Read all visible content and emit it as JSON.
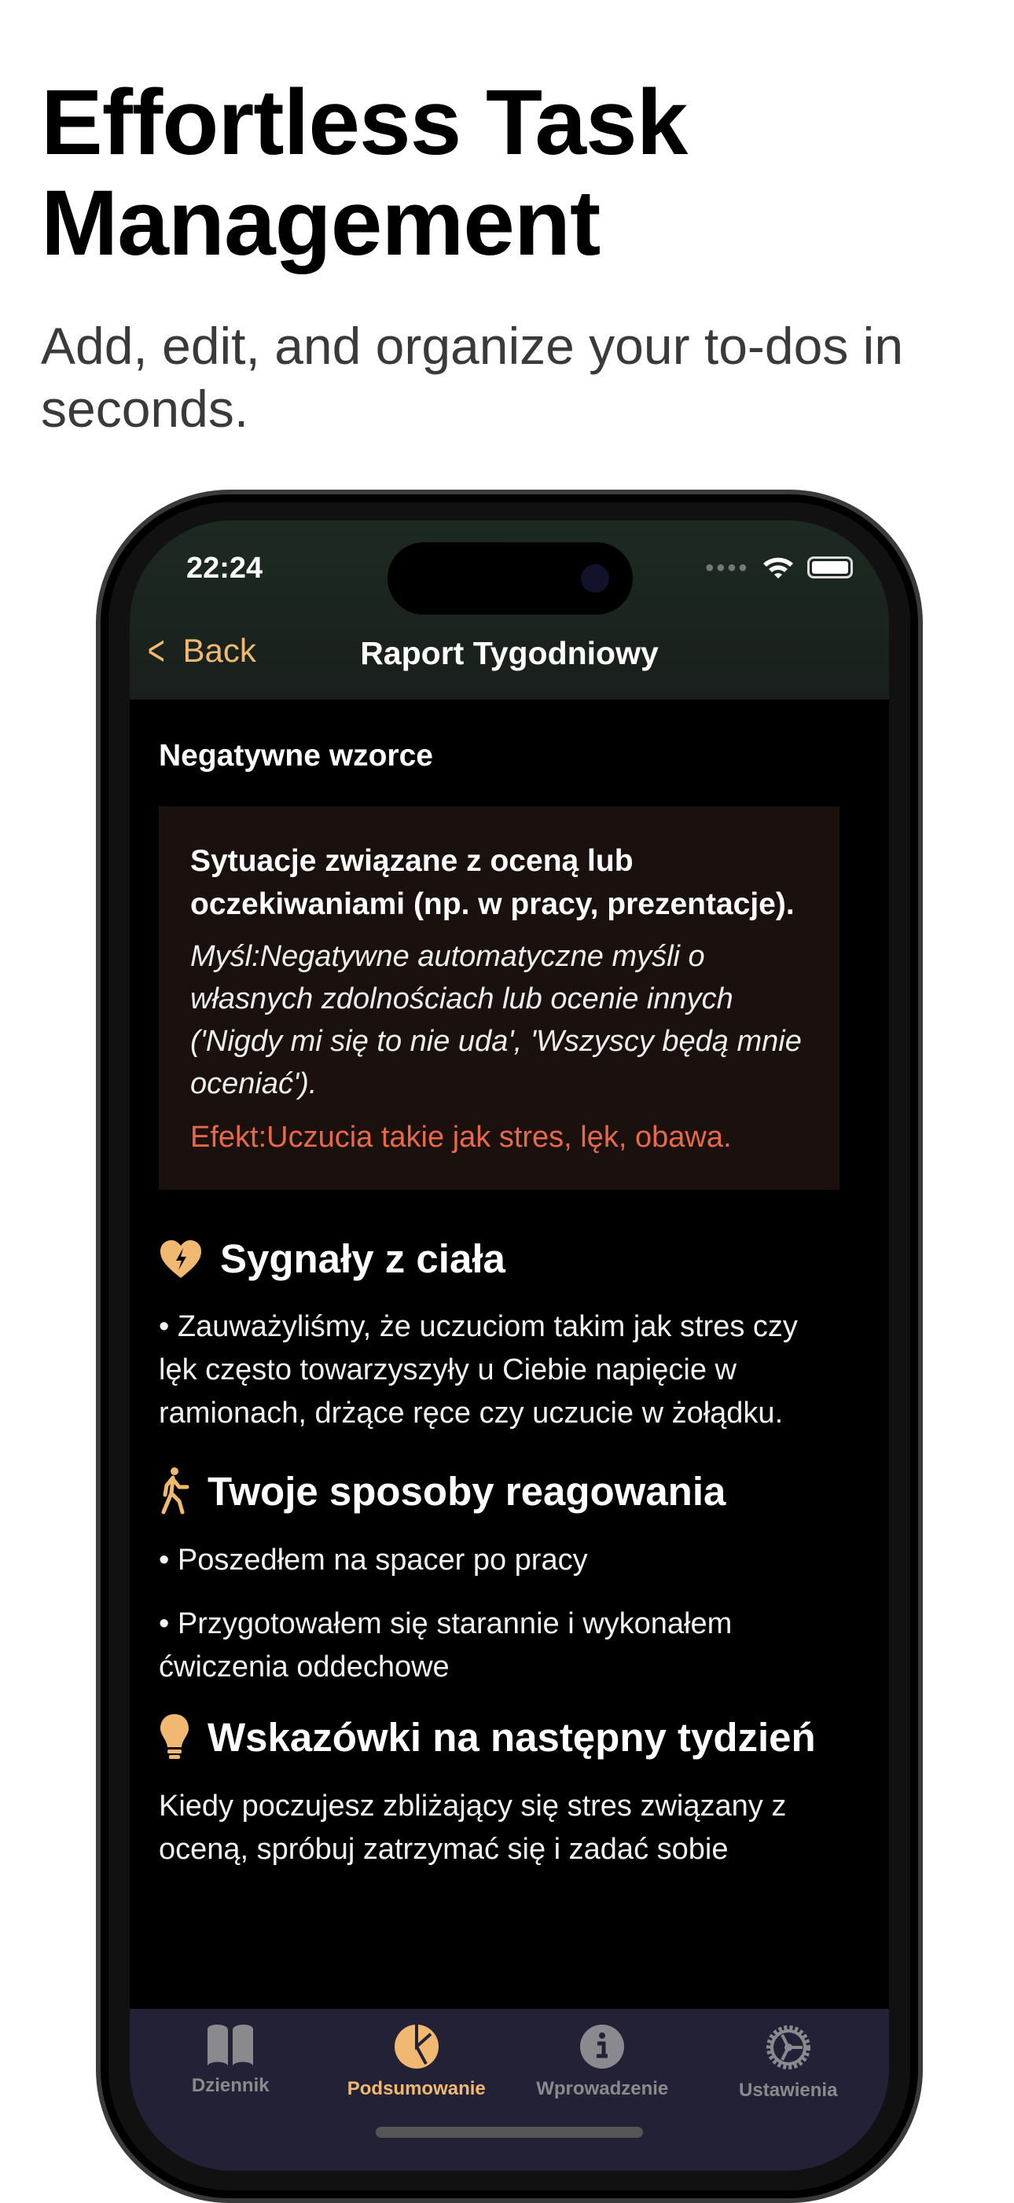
{
  "hero": {
    "title_line1": "Effortless Task",
    "title_line2": "Management",
    "subtitle": "Add, edit, and organize your to-dos in seconds."
  },
  "status": {
    "time": "22:24"
  },
  "nav": {
    "back_label": "Back",
    "title": "Raport Tygodniowy"
  },
  "negative_patterns": {
    "label": "Negatywne wzorce",
    "situation": "Sytuacje związane z oceną lub oczekiwaniami (np. w pracy, prezentacje).",
    "thought": "Myśl:Negatywne automatyczne myśli o własnych zdolnościach lub ocenie innych ('Nigdy mi się to nie uda', 'Wszyscy będą mnie oceniać').",
    "effect": "Efekt:Uczucia takie jak stres, lęk, obawa."
  },
  "body_signals": {
    "title": "Sygnały z ciała",
    "icon": "heart-bolt-icon",
    "items": [
      "• Zauważyliśmy, że uczuciom takim jak stres czy lęk często towarzyszyły u Ciebie napięcie w ramionach, drżące ręce czy uczucie w żołądku."
    ]
  },
  "reactions": {
    "title": "Twoje sposoby reagowania",
    "icon": "walking-figure-icon",
    "items": [
      "• Poszedłem na spacer po pracy",
      "• Przygotowałem się starannie i wykonałem ćwiczenia oddechowe"
    ]
  },
  "tips": {
    "title": "Wskazówki na następny tydzień",
    "icon": "lightbulb-icon",
    "text": "Kiedy poczujesz zbliżający się stres związany z oceną, spróbuj zatrzymać się i zadać sobie"
  },
  "tabs": [
    {
      "label": "Dziennik",
      "icon": "book-icon"
    },
    {
      "label": "Podsumowanie",
      "icon": "pie-chart-icon",
      "active": true
    },
    {
      "label": "Wprowadzenie",
      "icon": "info-icon"
    },
    {
      "label": "Ustawienia",
      "icon": "gear-icon"
    }
  ],
  "colors": {
    "accent": "#f0b870",
    "effect": "#e8684a",
    "tabbar": "#232136",
    "card": "#1a100d"
  }
}
